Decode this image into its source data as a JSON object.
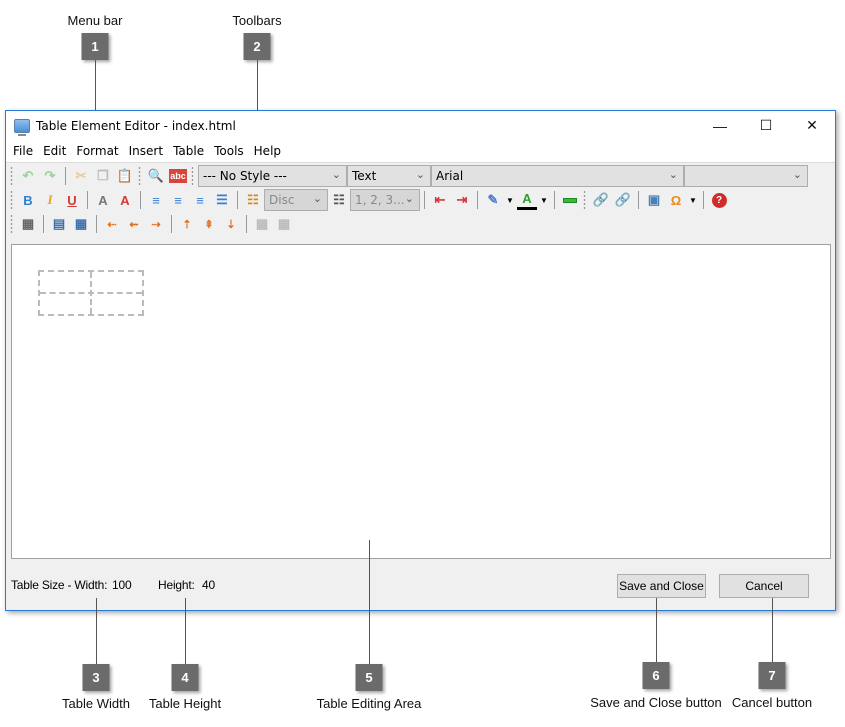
{
  "callouts": [
    {
      "num": "1",
      "label": "Menu bar"
    },
    {
      "num": "2",
      "label": "Toolbars"
    },
    {
      "num": "3",
      "label": "Table Width"
    },
    {
      "num": "4",
      "label": "Table Height"
    },
    {
      "num": "5",
      "label": "Table Editing Area"
    },
    {
      "num": "6",
      "label": "Save and Close button"
    },
    {
      "num": "7",
      "label": "Cancel button"
    }
  ],
  "window": {
    "title": "Table Element Editor - index.html",
    "minimize": "—",
    "maximize": "☐",
    "close": "✕"
  },
  "menu": [
    "File",
    "Edit",
    "Format",
    "Insert",
    "Table",
    "Tools",
    "Help"
  ],
  "toolbar": {
    "style_select": "--- No Style ---",
    "format_select": "Text",
    "font_select": "Arial",
    "size_select": "",
    "bullet_select": "Disc",
    "number_select": "1, 2, 3...",
    "spell_label": "abc",
    "bold": "B",
    "italic": "I",
    "underline": "U",
    "subscript": "A",
    "superscript": "A",
    "omega": "Ω",
    "help": "?"
  },
  "status": {
    "width_label": "Table Size - Width:",
    "width_value": "100",
    "height_label": "Height:",
    "height_value": "40"
  },
  "buttons": {
    "save_close": "Save and Close",
    "cancel": "Cancel"
  },
  "colors": {
    "window_border": "#2b79d6",
    "badge": "#6b6b6b"
  }
}
